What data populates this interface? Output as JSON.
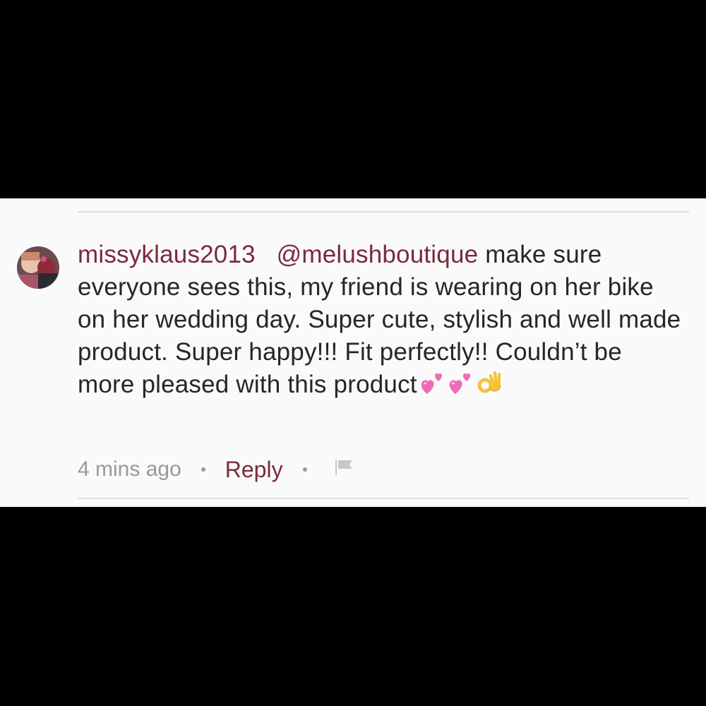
{
  "comment": {
    "username": "missyklaus2013",
    "mention": "@melushboutique",
    "text_line_1": " make sure everyone sees this, my friend is wearing on her bike on her wedding day. Super cute, stylish and well made product. Super happy!!! Fit perfectly!! Couldn’t be more pleased with this product",
    "emojis": [
      "two-hearts-icon",
      "two-hearts-icon",
      "ok-hand-icon"
    ],
    "timestamp": "4 mins ago",
    "reply_label": "Reply",
    "flag_icon": "flag-icon"
  },
  "colors": {
    "background_outer": "#000000",
    "card_background": "#fafafa",
    "username_color": "#7a2a3a",
    "text_color": "#262626",
    "meta_color": "#999999",
    "heart_color": "#f06bb6",
    "ok_hand_color": "#f5c33b"
  }
}
